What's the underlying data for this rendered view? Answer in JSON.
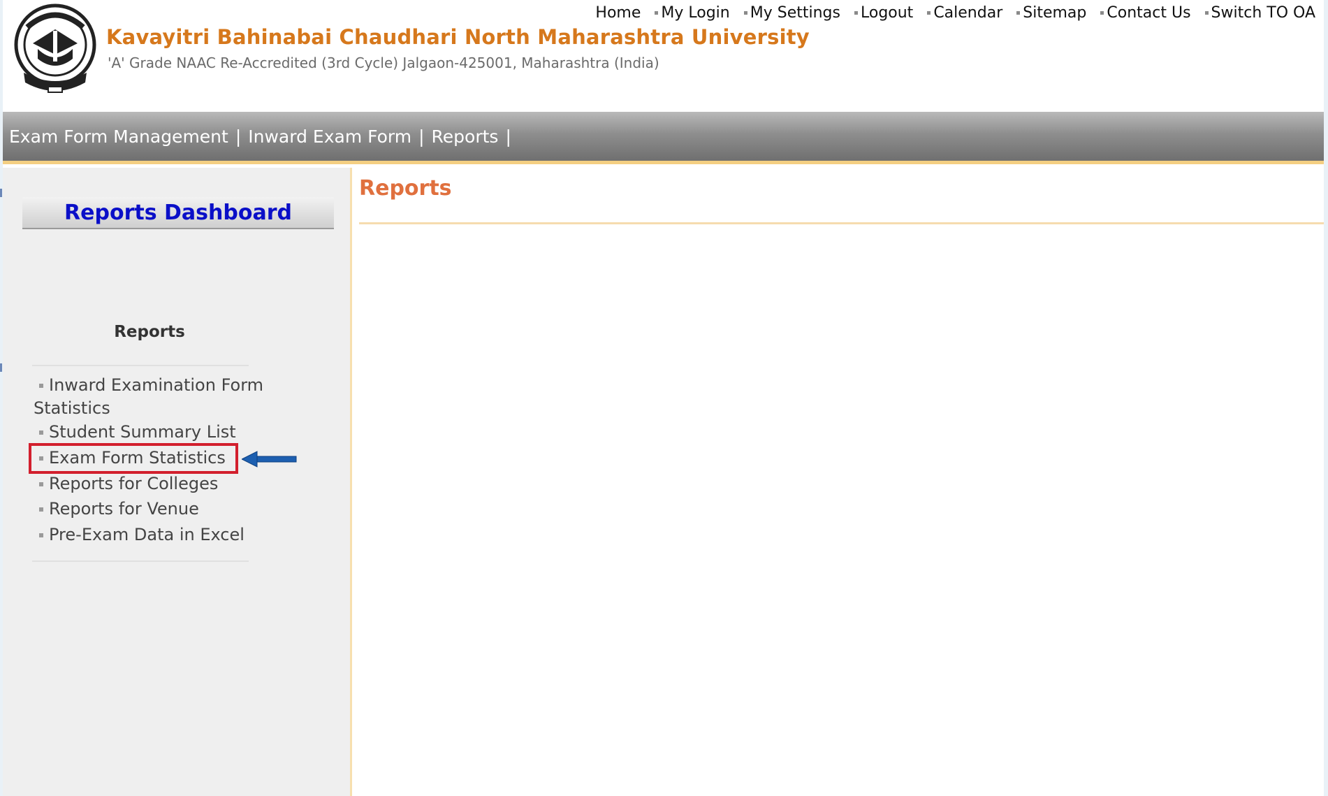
{
  "header": {
    "university_name": "Kavayitri Bahinabai Chaudhari North Maharashtra University",
    "subtitle": "'A' Grade NAAC Re-Accredited (3rd Cycle) Jalgaon-425001, Maharashtra (India)",
    "logo_icon": "university-seal-icon",
    "top_links": [
      "Home",
      "My Login",
      "My Settings",
      "Logout",
      "Calendar",
      "Sitemap",
      "Contact Us",
      "Switch TO OA"
    ]
  },
  "navbar": {
    "items": [
      "Exam Form Management",
      "Inward Exam Form",
      "Reports"
    ]
  },
  "sidebar": {
    "dashboard_title": "Reports Dashboard",
    "heading": "Reports",
    "items": [
      "Inward Examination Form Statistics",
      "Student Summary List",
      "Exam Form Statistics",
      "Reports for Colleges",
      "Reports for Venue",
      "Pre-Exam Data in Excel"
    ],
    "highlighted_item": "Exam Form Statistics"
  },
  "main": {
    "title": "Reports"
  },
  "colors": {
    "brand_orange": "#d6781c",
    "dashboard_blue": "#0a0fc8",
    "main_title": "#e0703e",
    "highlight_red": "#d21f2d",
    "arrow_blue": "#1d5fb0",
    "nav_accent": "#f4cf82"
  }
}
